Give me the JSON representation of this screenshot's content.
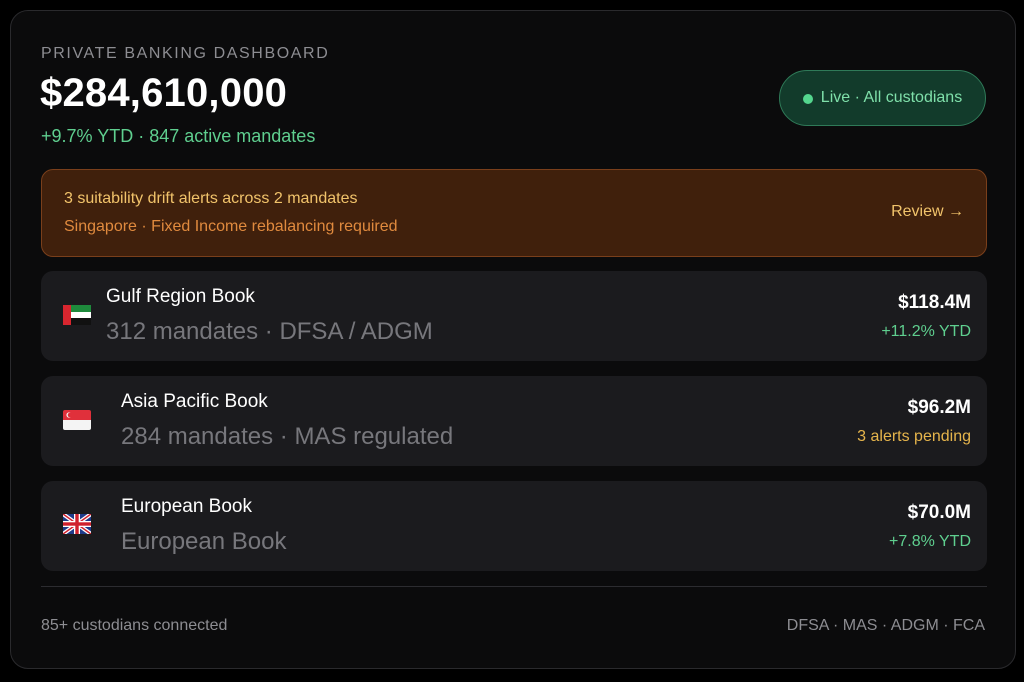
{
  "header": {
    "eyebrow": "PRIVATE BANKING DASHBOARD",
    "total_aum": "$284,610,000",
    "subline": "+9.7% YTD · 847 active mandates"
  },
  "live_status": {
    "label": "Live · All custodians",
    "color": "#54d68e"
  },
  "alert": {
    "title": "3 suitability drift alerts across 2 mandates",
    "subtitle": "Singapore · Fixed Income rebalancing required",
    "action": "Review →"
  },
  "books": [
    {
      "flag": "uae-flag-icon",
      "name": "Gulf Region Book",
      "detail": "312 mandates · DFSA / ADGM",
      "value": "$118.4M",
      "status": "+11.2% YTD",
      "status_color": "#5fcf8f"
    },
    {
      "flag": "singapore-flag-icon",
      "name": "Asia Pacific Book",
      "detail": "284 mandates · MAS regulated",
      "value": "$96.2M",
      "status": "3 alerts pending",
      "status_color": "#e6b54c"
    },
    {
      "flag": "uk-flag-icon",
      "name": "European Book",
      "detail": "European Book",
      "value": "$70.0M",
      "status": "+7.8% YTD",
      "status_color": "#5fcf8f"
    }
  ],
  "footer": {
    "left": "85+ custodians connected",
    "right": "DFSA · MAS · ADGM · FCA"
  }
}
